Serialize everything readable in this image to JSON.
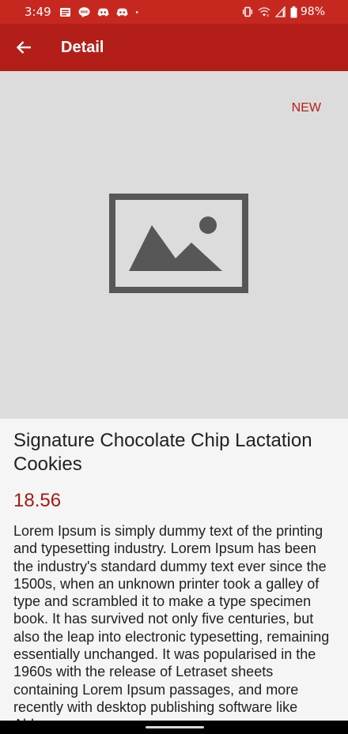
{
  "status_bar": {
    "time": "3:49",
    "left_icons": [
      "news-icon",
      "line-app-icon",
      "discord-icon",
      "discord-icon",
      "notification-dot-icon"
    ],
    "right_icons": [
      "vibrate-icon",
      "wifi-icon",
      "signal-icon",
      "battery-icon"
    ],
    "battery_percent": "98%"
  },
  "app_bar": {
    "back_icon": "arrow-back-icon",
    "title": "Detail"
  },
  "hero": {
    "badge": "NEW",
    "image_icon": "image-placeholder-icon"
  },
  "product": {
    "title": "Signature Chocolate Chip Lactation Cookies",
    "price": "18.56",
    "description": "Lorem Ipsum is simply dummy text of the printing and typesetting industry. Lorem Ipsum has been the industry's standard dummy text ever since the 1500s, when an unknown printer took a galley of type and scrambled it to make a type specimen book. It has survived not only five centuries, but also the leap into electronic typesetting, remaining essentially unchanged. It was popularised in the 1960s with the release of Letraset sheets containing Lorem Ipsum passages, and more recently with desktop publishing software like Aldus"
  },
  "colors": {
    "status_bar": "#c6281f",
    "app_bar": "#b31f18",
    "accent": "#b31f18",
    "price": "#a31b14",
    "hero_background": "#dcdcdc",
    "page_background": "#f5f5f5"
  }
}
